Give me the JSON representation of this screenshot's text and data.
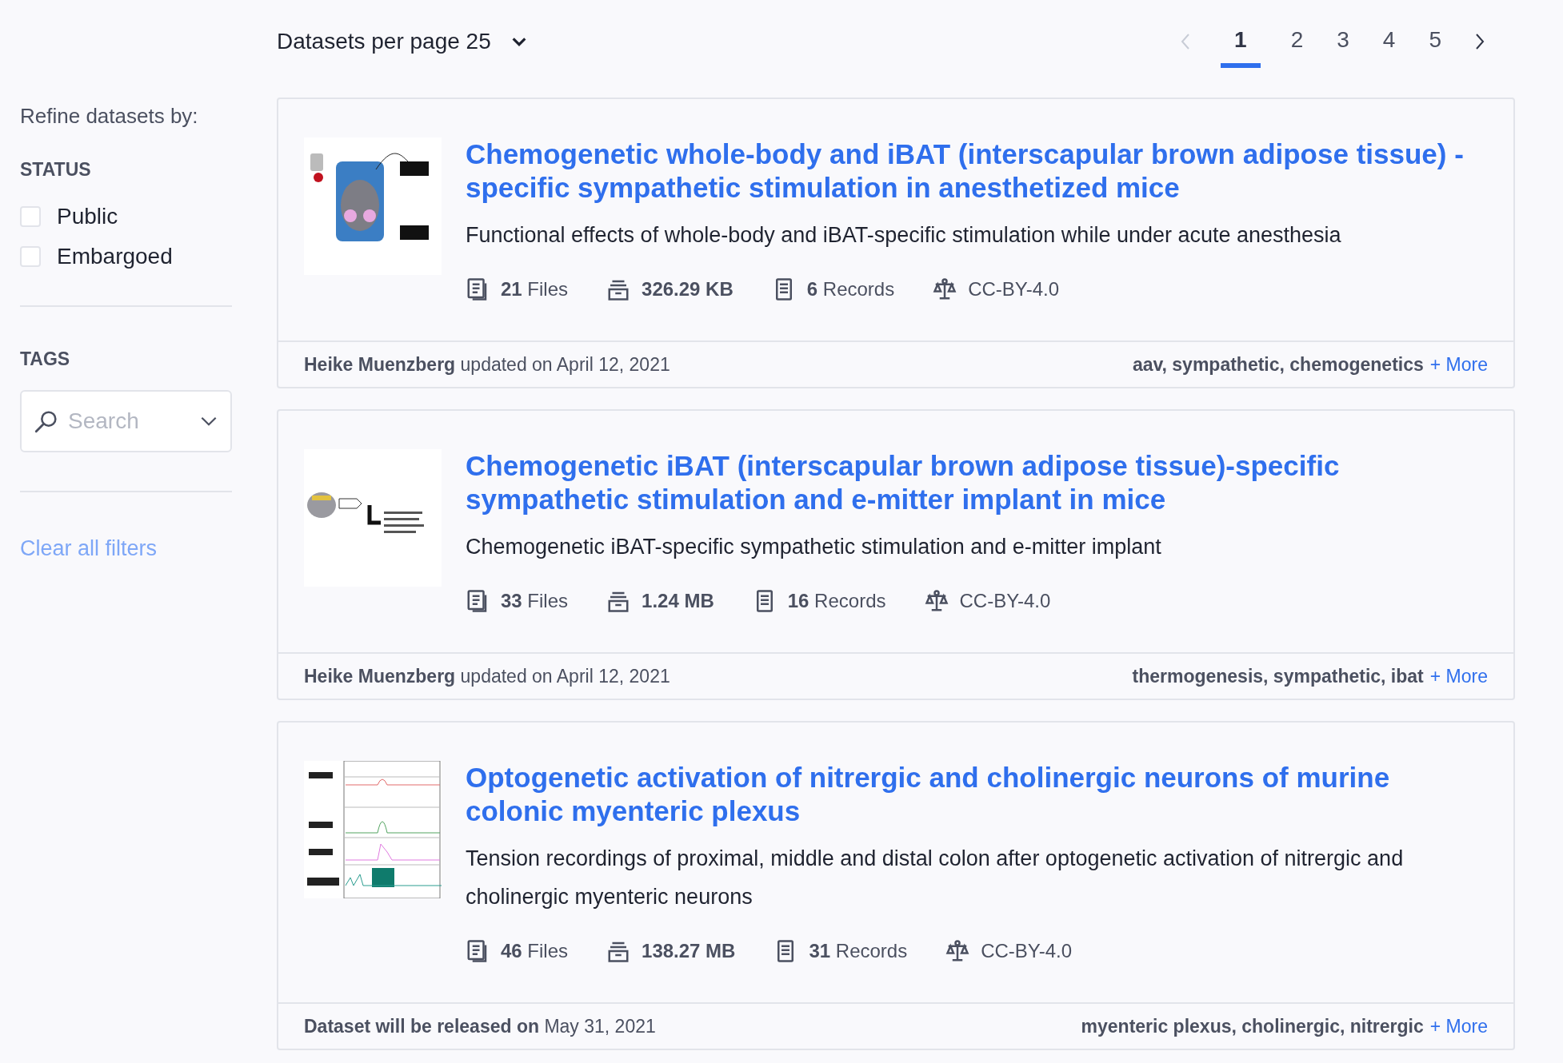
{
  "sidebar": {
    "heading": "Refine datasets by:",
    "status_title": "STATUS",
    "status_options": [
      {
        "label": "Public",
        "checked": false
      },
      {
        "label": "Embargoed",
        "checked": false
      }
    ],
    "tags_title": "TAGS",
    "tags_search": {
      "placeholder": "Search"
    },
    "clear_link": "Clear all filters"
  },
  "toolbar": {
    "per_page": "Datasets per page 25"
  },
  "pagination": {
    "pages": [
      {
        "label": "1",
        "selected": true
      },
      {
        "label": "2",
        "selected": false
      },
      {
        "label": "3",
        "selected": false
      },
      {
        "label": "4",
        "selected": false
      },
      {
        "label": "5",
        "selected": false
      }
    ]
  },
  "datasets": [
    {
      "thumbnail": {
        "kind": "picture"
      },
      "title": "Chemogenetic whole-body and iBAT (interscapular brown adipose tissue) - specific sympathetic stimulation in anesthetized mice",
      "description": "Functional effects of whole-body and iBAT-specific stimulation while under acute anesthesia",
      "stats": [
        {
          "kind": "files",
          "text": "**21** Files"
        },
        {
          "kind": "size",
          "text": "**326.29 KB**"
        },
        {
          "kind": "records",
          "text": "**6** Records"
        },
        {
          "kind": "license",
          "text": "CC-BY-4.0"
        }
      ],
      "footer": "**Heike Muenzberg** updated on April 12, 2021",
      "tags": "aav, sympathetic, chemogenetics",
      "more": "+ More"
    },
    {
      "thumbnail": {
        "kind": "picture"
      },
      "title": "Chemogenetic iBAT (interscapular brown adipose tissue)-specific sympathetic stimulation and e-mitter implant in mice",
      "description": "Chemogenetic iBAT-specific sympathetic stimulation and e-mitter implant",
      "stats": [
        {
          "kind": "files",
          "text": "**33** Files"
        },
        {
          "kind": "size",
          "text": "**1.24 MB**"
        },
        {
          "kind": "records",
          "text": "**16** Records"
        },
        {
          "kind": "license",
          "text": "CC-BY-4.0"
        }
      ],
      "footer": "**Heike Muenzberg** updated on April 12, 2021",
      "tags": "thermogenesis, sympathetic, ibat",
      "more": "+ More"
    },
    {
      "thumbnail": {
        "kind": "picture"
      },
      "title": "Optogenetic activation of nitrergic and cholinergic neurons of murine colonic myenteric plexus",
      "description": "Tension recordings of proximal, middle and distal colon after optogenetic activation of nitrergic and cholinergic myenteric neurons",
      "stats": [
        {
          "kind": "files",
          "text": "**46** Files"
        },
        {
          "kind": "size",
          "text": "**138.27 MB**"
        },
        {
          "kind": "records",
          "text": "**31** Records"
        },
        {
          "kind": "license",
          "text": "CC-BY-4.0"
        }
      ],
      "footer": "**Dataset will be released on** May 31, 2021",
      "tags": "myenteric plexus, cholinergic, nitrergic",
      "more": "+ More"
    }
  ]
}
